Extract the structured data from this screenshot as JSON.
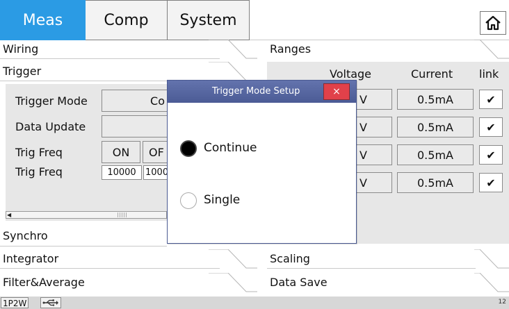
{
  "tabs": [
    {
      "label": "Meas",
      "active": true
    },
    {
      "label": "Comp",
      "active": false
    },
    {
      "label": "System",
      "active": false
    }
  ],
  "home_icon": "home-icon",
  "left_sections": {
    "wiring": "Wiring",
    "trigger": "Trigger",
    "synchro": "Synchro",
    "integrator": "Integrator",
    "filter_average": "Filter&Average"
  },
  "right_sections": {
    "ranges": "Ranges",
    "scaling": "Scaling",
    "data_save": "Data Save"
  },
  "trigger_panel": {
    "trigger_mode_label": "Trigger Mode",
    "trigger_mode_value": "Co",
    "data_update_label": "Data Update",
    "trig_freq_label_1": "Trig Freq",
    "on_label": "ON",
    "off_label": "OF",
    "trig_freq_label_2": "Trig Freq",
    "freq_value_1": "10000",
    "freq_value_2": "1000"
  },
  "ranges_panel": {
    "columns": {
      "voltage": "Voltage",
      "current": "Current",
      "link": "link"
    },
    "rows": [
      {
        "voltage": "V",
        "current": "0.5mA",
        "link": "✔"
      },
      {
        "voltage": "V",
        "current": "0.5mA",
        "link": "✔"
      },
      {
        "voltage": "V",
        "current": "0.5mA",
        "link": "✔"
      },
      {
        "voltage": "V",
        "current": "0.5mA",
        "link": "✔"
      }
    ]
  },
  "dialog": {
    "title": "Trigger Mode Setup",
    "close_glyph": "×",
    "options": [
      {
        "label": "Continue",
        "selected": true
      },
      {
        "label": "Single",
        "selected": false
      }
    ]
  },
  "status_bar": {
    "mode": "1P2W",
    "usb_icon": "usb-icon",
    "number": "12"
  },
  "colors": {
    "active_tab": "#2b9be4",
    "dialog_title": "#5262a0",
    "close_button": "#e1414a",
    "panel_gray": "#e7e7e7"
  }
}
